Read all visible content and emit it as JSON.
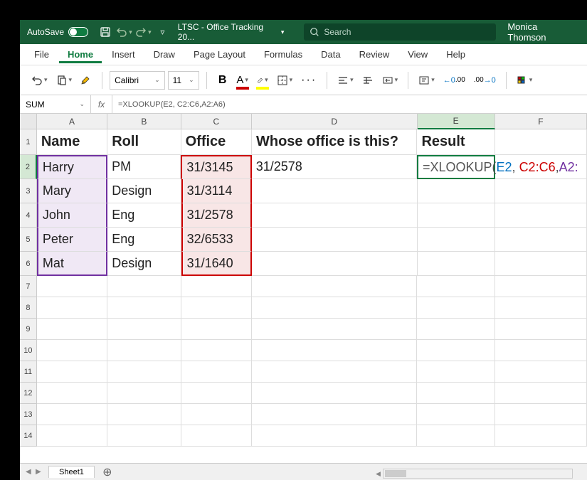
{
  "titlebar": {
    "autosave_label": "AutoSave",
    "autosave_state": "On",
    "doc_title": "LTSC - Office Tracking 20...",
    "search_placeholder": "Search",
    "user_name": "Monica Thomson"
  },
  "ribbon": {
    "tabs": [
      "File",
      "Home",
      "Insert",
      "Draw",
      "Page Layout",
      "Formulas",
      "Data",
      "Review",
      "View",
      "Help"
    ],
    "active_tab": 1,
    "font_name": "Calibri",
    "font_size": "11",
    "font_color": "#c00000",
    "highlight_color": "#ffff00"
  },
  "formula_bar": {
    "name_box": "SUM",
    "formula": "=XLOOKUP(E2, C2:C6,A2:A6)"
  },
  "columns": [
    "A",
    "B",
    "C",
    "D",
    "E",
    "F"
  ],
  "active_col": 4,
  "active_row": 2,
  "rows": [
    1,
    2,
    3,
    4,
    5,
    6,
    7,
    8,
    9,
    10,
    11,
    12,
    13,
    14
  ],
  "data": {
    "headers": [
      "Name",
      "Roll",
      "Office",
      "Whose office is this?",
      "Result"
    ],
    "body": [
      [
        "Harry",
        "PM",
        "31/3145",
        "31/2578"
      ],
      [
        "Mary",
        "Design",
        "31/3114",
        ""
      ],
      [
        "John",
        "Eng",
        "31/2578",
        ""
      ],
      [
        "Peter",
        "Eng",
        "32/6533",
        ""
      ],
      [
        "Mat",
        "Design",
        "31/1640",
        ""
      ]
    ],
    "formula_display": {
      "prefix": "=XLOOKUP(",
      "arg1": "E2",
      "sep1": ", ",
      "arg2": "C2:C6",
      "sep2": ",",
      "arg3": "A2:"
    }
  },
  "sheet_tabs": {
    "active": "Sheet1"
  }
}
